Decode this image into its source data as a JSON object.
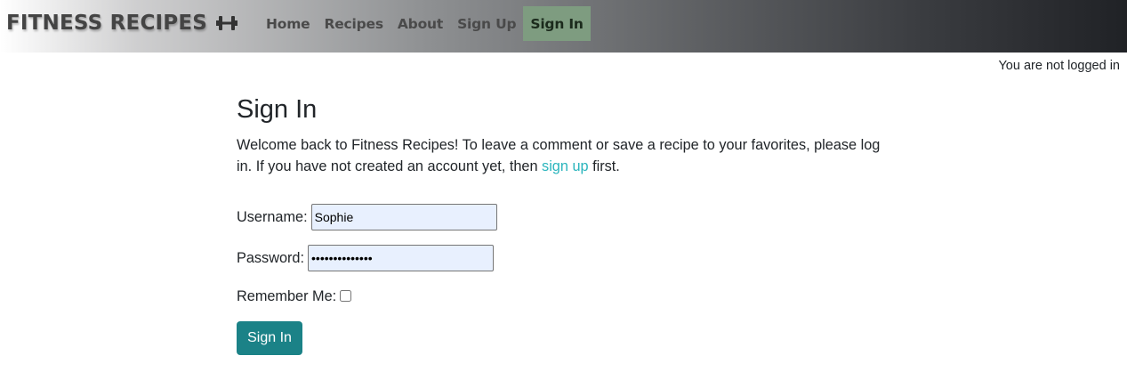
{
  "nav": {
    "brand": "FITNESS RECIPES",
    "brand_icon": "dumbbell-icon",
    "links": [
      {
        "label": "Home"
      },
      {
        "label": "Recipes"
      },
      {
        "label": "About"
      },
      {
        "label": "Sign Up"
      },
      {
        "label": "Sign In",
        "active": true
      }
    ]
  },
  "status": {
    "text": "You are not logged in"
  },
  "page": {
    "title": "Sign In",
    "intro_before": "Welcome back to Fitness Recipes! To leave a comment or save a recipe to your favorites, please log in. If you have not created an account yet, then ",
    "intro_link": "sign up",
    "intro_after": " first."
  },
  "form": {
    "username_label": "Username:",
    "username_value": "Sophie",
    "password_label": "Password:",
    "password_value": "••••••••••••••",
    "remember_label": "Remember Me:",
    "remember_checked": false,
    "submit_label": "Sign In"
  },
  "colors": {
    "accent": "#1b8287",
    "link": "#2bb5bd",
    "active_nav": "#7e9c80",
    "autofill_bg": "#e8f0fe"
  }
}
